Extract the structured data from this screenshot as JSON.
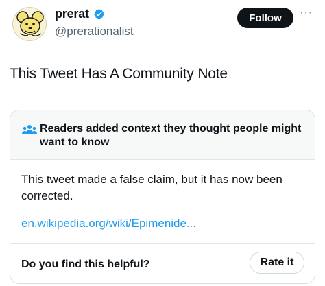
{
  "author": {
    "display_name": "prerat",
    "handle": "@prerationalist",
    "verified": true,
    "avatar_icon": "mouse-avatar"
  },
  "actions": {
    "follow_label": "Follow",
    "more_label": "···"
  },
  "tweet": {
    "text": "This Tweet Has A Community Note"
  },
  "community_note": {
    "icon": "readers-icon",
    "title": "Readers added context they thought people might want to know",
    "body": "This tweet made a false claim, but it has now been corrected.",
    "link": "en.wikipedia.org/wiki/Epimenide...",
    "helpful_question": "Do you find this helpful?",
    "rate_label": "Rate it"
  },
  "colors": {
    "accent": "#1d9bf0",
    "text": "#0f1419",
    "muted": "#536471"
  }
}
